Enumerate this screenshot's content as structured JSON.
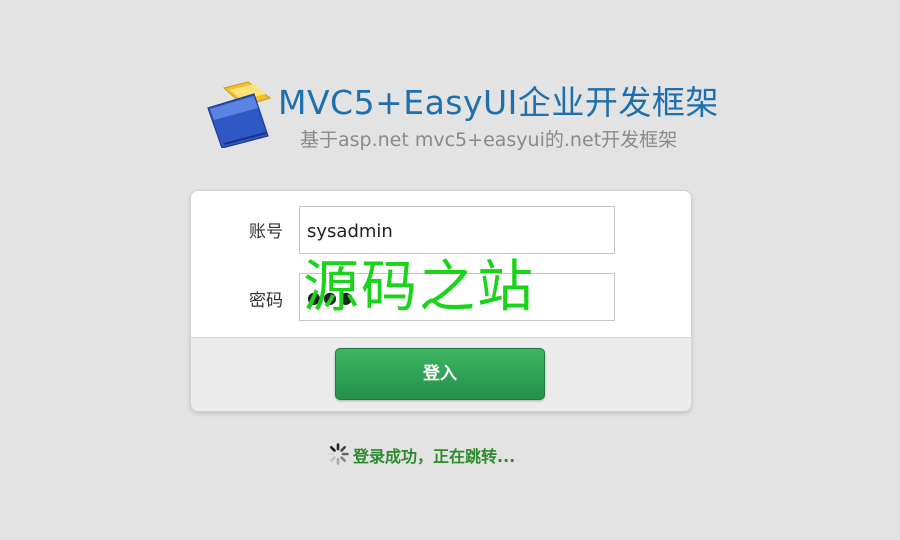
{
  "header": {
    "title": "MVC5+EasyUI企业开发框架",
    "subtitle": "基于asp.net mvc5+easyui的.net开发框架"
  },
  "form": {
    "username_label": "账号",
    "username_value": "sysadmin",
    "password_label": "密码",
    "password_value": "●●●",
    "login_label": "登入"
  },
  "status": {
    "message": "登录成功，正在跳转..."
  },
  "watermark": {
    "text": "源码之站"
  },
  "icons": {
    "logo": "folder-icon",
    "status": "spinner-icon"
  },
  "colors": {
    "title": "#1d6fae",
    "button": "#2fa455",
    "status": "#2e8a2e",
    "watermark": "#19d419"
  }
}
